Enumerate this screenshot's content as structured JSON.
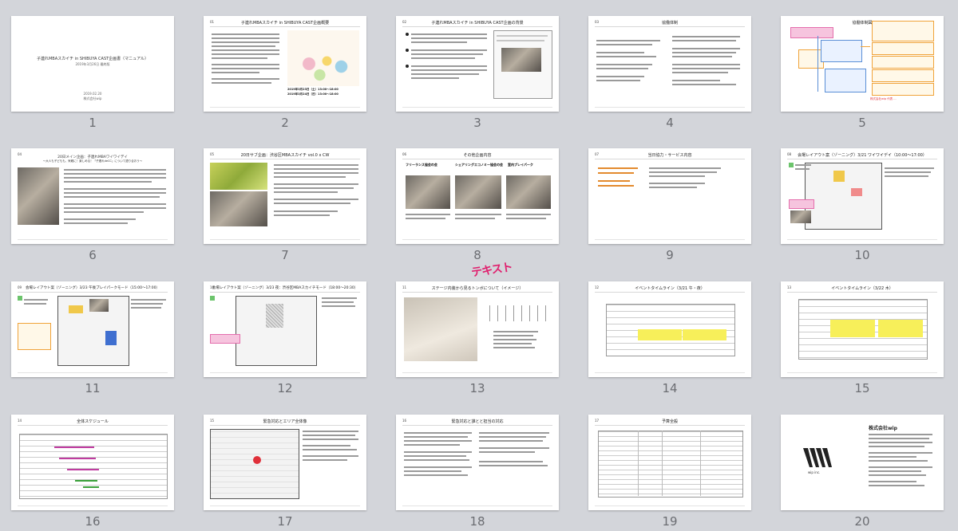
{
  "slides": [
    {
      "n": "1",
      "title": "子連れMBAスカイチ in SHIBUYA CAST企画書（マニュアル）",
      "sub": "2019年3月26日 最終版",
      "date": "2019.02.20",
      "company": "株式会社wip"
    },
    {
      "n": "2",
      "slide_no": "01",
      "title": "子連れMBAスカイチ in SHIBUYA CAST企画概要",
      "date_line1": "2019年3月23日（土）13:00〜18:00",
      "date_line2": "2019年3月24日（日）13:00〜18:00"
    },
    {
      "n": "3",
      "slide_no": "02",
      "title": "子連れMBAスカイチ in SHIBUYA CAST企画の背景"
    },
    {
      "n": "4",
      "slide_no": "03",
      "title": "協働体制"
    },
    {
      "n": "5",
      "slide_no": "",
      "title": "協働体制図",
      "bottom_note": "株式会社wip 代表 ..."
    },
    {
      "n": "6",
      "slide_no": "04",
      "title": "20日メイン企画：子連れMBAワイワイデイ",
      "sub": "〜大人も子どもも、気軽に！楽しめる！「子連れdeCC」について語り合おう〜"
    },
    {
      "n": "7",
      "slide_no": "05",
      "title": "20日サブ企画：渋谷区MBAスカイチ vol.0 x CW"
    },
    {
      "n": "8",
      "slide_no": "06",
      "title": "その他企画内容",
      "col1": "フリーランス協会の会",
      "col2": "シェアリングエコノミー協会の会",
      "col3": "室内プレイパーク"
    },
    {
      "n": "9",
      "slide_no": "07",
      "title": "当日協力・サービス内容"
    },
    {
      "n": "10",
      "slide_no": "08",
      "title": "会場レイアウト案（ゾーニング）3/21 ワイワイデイ（10:00〜17:00）"
    },
    {
      "n": "11",
      "slide_no": "09",
      "title": "会場レイアウト案（ゾーニング）3/23 午後プレイパークモード（15:00〜17:00）"
    },
    {
      "n": "12",
      "slide_no": "10",
      "title": "会場レイアウト案（ゾーニング）3/23 夜：渋谷区MBAスカイチモード（18:00〜20:30）"
    },
    {
      "n": "13",
      "slide_no": "11",
      "title": "ステージ内装から見るトンボについて（イメージ）"
    },
    {
      "n": "14",
      "slide_no": "12",
      "title": "イベントタイムライン（3/21 午・夜）"
    },
    {
      "n": "15",
      "slide_no": "13",
      "title": "イベントタイムライン（3/22 木）"
    },
    {
      "n": "16",
      "slide_no": "14",
      "title": "全体スケジュール"
    },
    {
      "n": "17",
      "slide_no": "15",
      "title": "緊急対応とエリア全体像"
    },
    {
      "n": "18",
      "slide_no": "16",
      "title": "緊急対応と誰とと担当の対応"
    },
    {
      "n": "19",
      "slide_no": "17",
      "title": "予算全般"
    },
    {
      "n": "20",
      "slide_no": "",
      "title": "株式会社wip",
      "logo_caption": "wip inc."
    }
  ],
  "watermark": "テキスト",
  "colors": {
    "background": "#d3d5da",
    "slide": "#ffffff",
    "page_number": "#6b6d72",
    "highlight": "#f7ef5a",
    "accent_pink": "#e46fad",
    "accent_orange": "#f0a33a",
    "accent_blue": "#5a8fd6"
  }
}
